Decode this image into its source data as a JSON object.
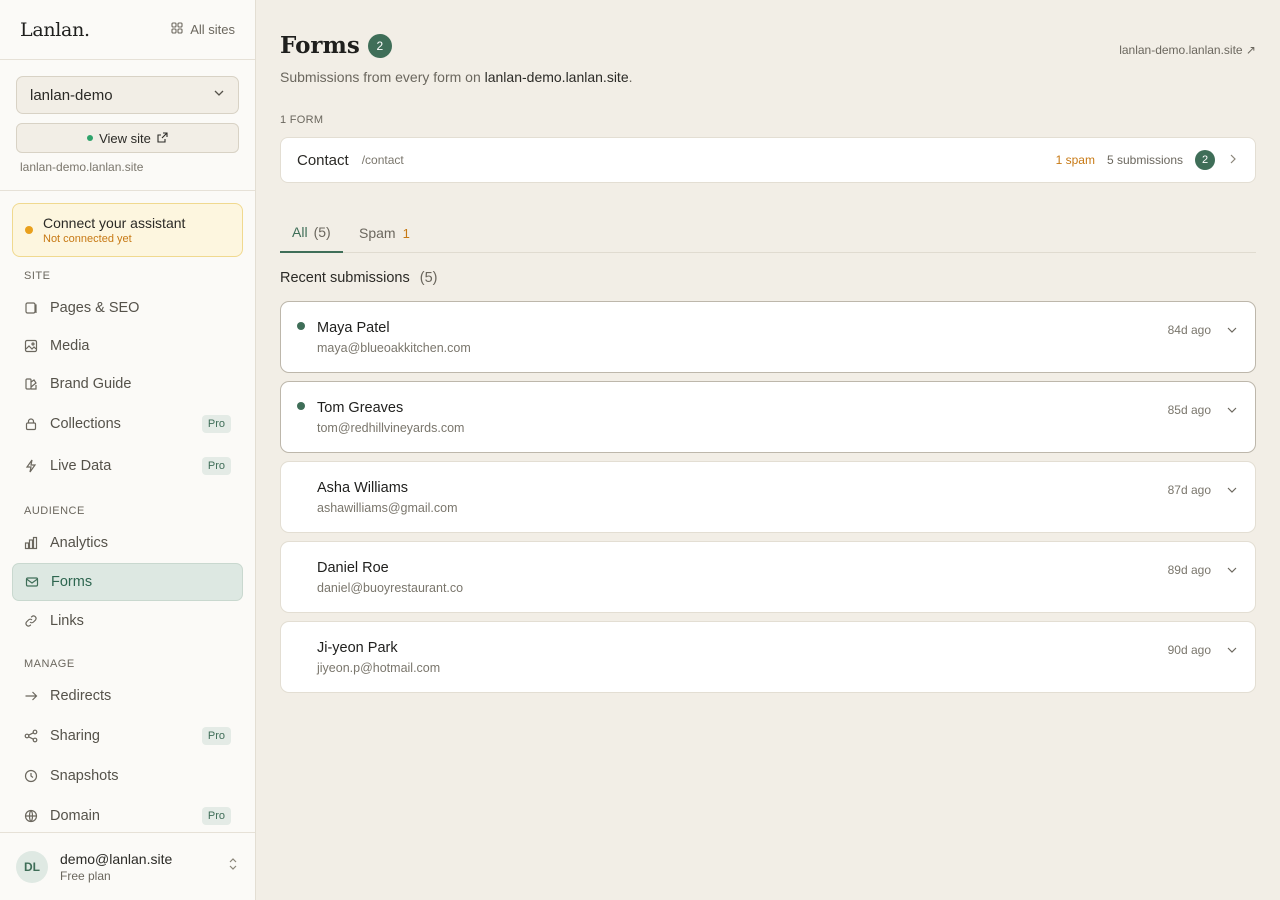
{
  "app": {
    "logo": "Lanlan.",
    "all_sites_label": "All sites"
  },
  "site": {
    "selected": "lanlan-demo",
    "view_site_label": "View site",
    "domain": "lanlan-demo.lanlan.site"
  },
  "assistant": {
    "title": "Connect your assistant",
    "status": "Not connected yet"
  },
  "nav": {
    "site_label": "SITE",
    "audience_label": "AUDIENCE",
    "manage_label": "MANAGE",
    "pro_badge": "Pro",
    "items": {
      "pages": "Pages & SEO",
      "media": "Media",
      "brand": "Brand Guide",
      "collections": "Collections",
      "livedata": "Live Data",
      "analytics": "Analytics",
      "forms": "Forms",
      "links": "Links",
      "redirects": "Redirects",
      "sharing": "Sharing",
      "snapshots": "Snapshots",
      "domain": "Domain"
    }
  },
  "user": {
    "initials": "DL",
    "email": "demo@lanlan.site",
    "plan": "Free plan"
  },
  "header": {
    "title": "Forms",
    "count": "2",
    "site_link": "lanlan-demo.lanlan.site ↗",
    "subtitle_prefix": "Submissions from every form on",
    "subtitle_site": "lanlan-demo.lanlan.site",
    "subtitle_suffix": "."
  },
  "forms_section": {
    "count_label": "1 FORM",
    "form": {
      "name": "Contact",
      "path": "/contact",
      "spam": "1 spam",
      "submissions": "5 submissions",
      "unread": "2"
    }
  },
  "tabs": {
    "all": {
      "label": "All",
      "count": "(5)"
    },
    "spam": {
      "label": "Spam",
      "count": "1"
    }
  },
  "recent": {
    "title": "Recent submissions",
    "count": "(5)"
  },
  "submissions": [
    {
      "name": "Maya Patel",
      "email": "maya@blueoakkitchen.com",
      "time": "84d ago",
      "unread": true
    },
    {
      "name": "Tom Greaves",
      "email": "tom@redhillvineyards.com",
      "time": "85d ago",
      "unread": true
    },
    {
      "name": "Asha Williams",
      "email": "ashawilliams@gmail.com",
      "time": "87d ago",
      "unread": false
    },
    {
      "name": "Daniel Roe",
      "email": "daniel@buoyrestaurant.co",
      "time": "89d ago",
      "unread": false
    },
    {
      "name": "Ji-yeon Park",
      "email": "jiyeon.p@hotmail.com",
      "time": "90d ago",
      "unread": false
    }
  ],
  "colors": {
    "accent": "#3f6e58",
    "warning": "#c77914",
    "background": "#f2eee6"
  }
}
